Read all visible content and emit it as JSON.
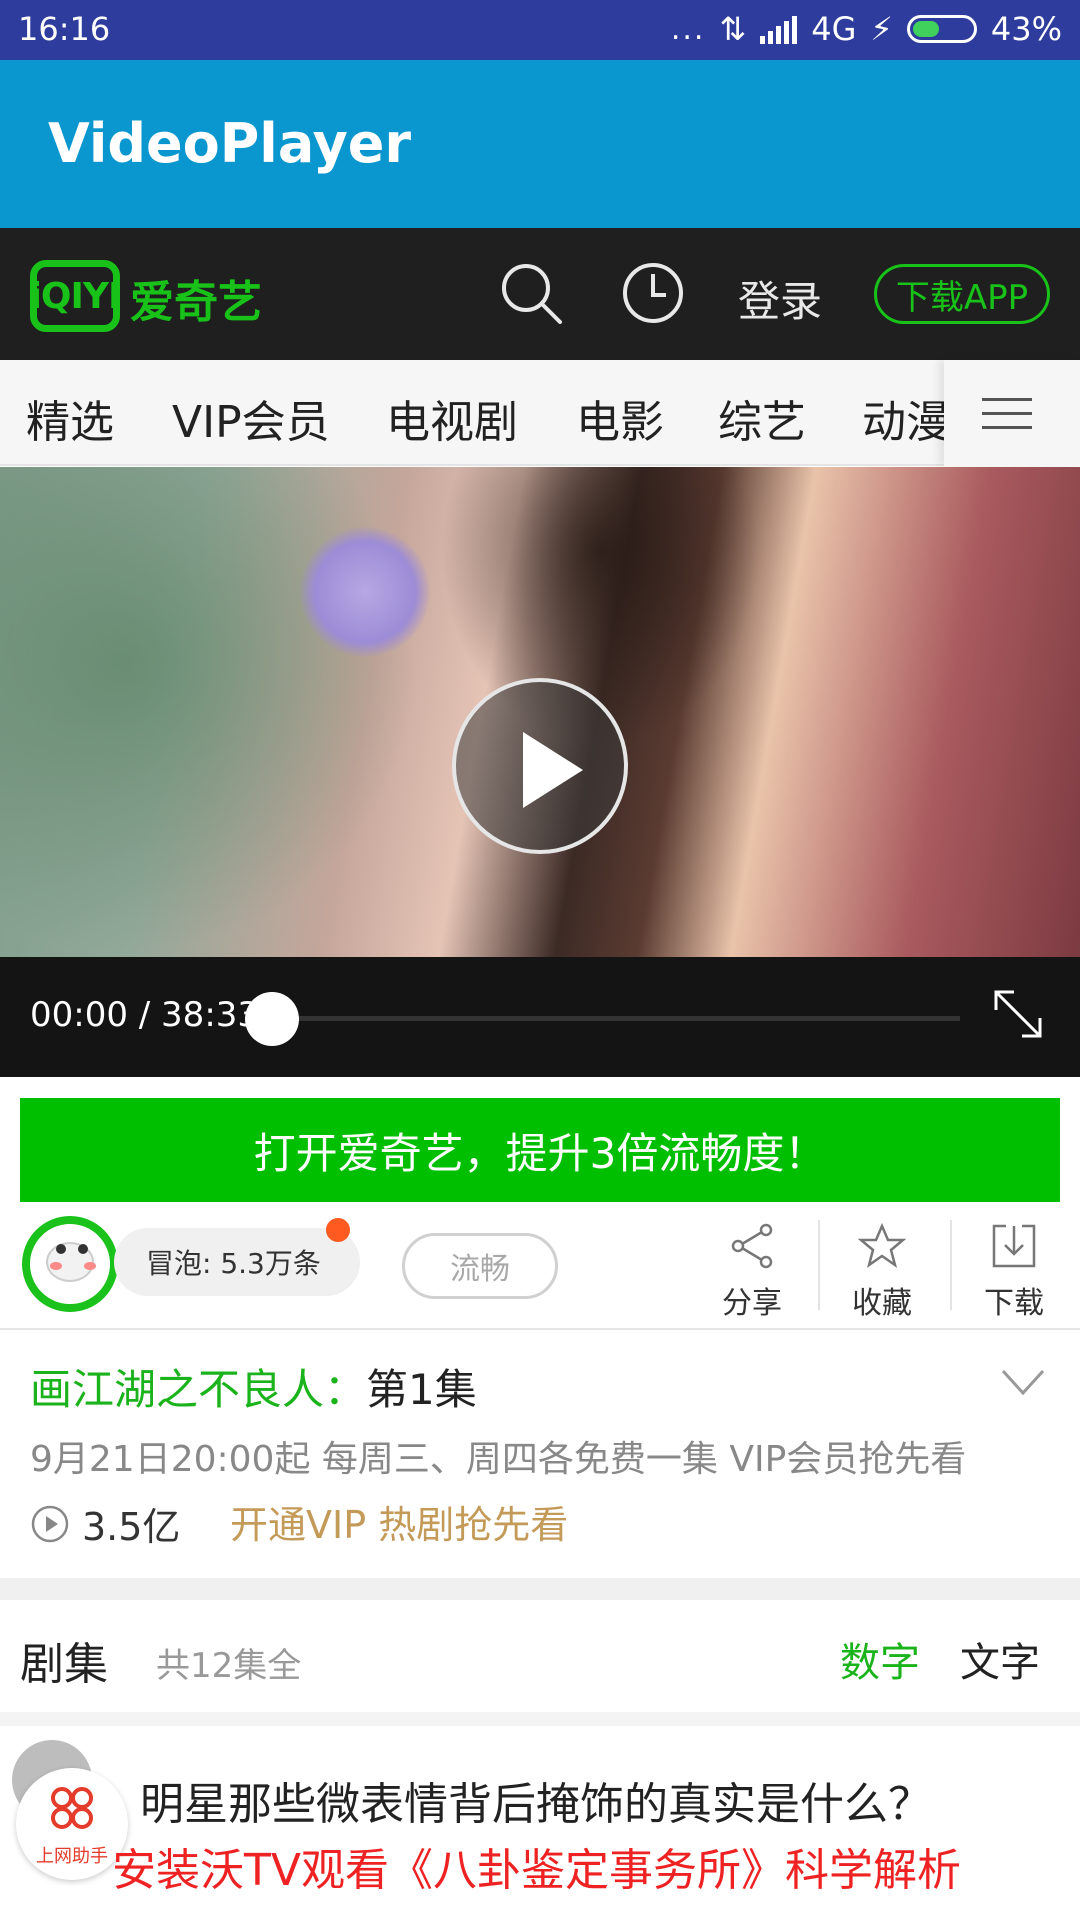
{
  "status_bar": {
    "time": "16:16",
    "dots": "...",
    "network": "4G",
    "battery": "43%"
  },
  "app_bar": {
    "title": "VideoPlayer"
  },
  "header": {
    "logo_mark": "iQIYI",
    "logo_text": "爱奇艺",
    "login": "登录",
    "download_app": "下载APP"
  },
  "nav": {
    "tabs": [
      "精选",
      "VIP会员",
      "电视剧",
      "电影",
      "综艺",
      "动漫"
    ]
  },
  "player": {
    "time": "00:00 / 38:33",
    "progress": 0
  },
  "promo": "打开爱奇艺，提升3倍流畅度！",
  "actions": {
    "bubble": "冒泡: 5.3万条",
    "quality": "流畅",
    "share": "分享",
    "favorite": "收藏",
    "download": "下载"
  },
  "episode": {
    "title_main": "画江湖之不良人：",
    "title_ep": "第1集",
    "schedule": "9月21日20:00起 每周三、周四各免费一集 VIP会员抢先看",
    "plays": "3.5亿",
    "vip_link": "开通VIP 热剧抢先看"
  },
  "episodes": {
    "title": "剧集",
    "count": "共12集全",
    "tab_number": "数字",
    "tab_text": "文字"
  },
  "ad": {
    "logo_caption": "上网助手",
    "line1": "明星那些微表情背后掩饰的真实是什么？",
    "line2": "安装沃TV观看《八卦鉴定事务所》科学解析"
  },
  "colors": {
    "status_bar": "#2e3d9d",
    "app_bar": "#0a97cf",
    "iqiyi_green": "#18c218",
    "promo_green": "#00bf00",
    "vip_gold": "#c49a59",
    "ad_red": "#ee2222"
  }
}
